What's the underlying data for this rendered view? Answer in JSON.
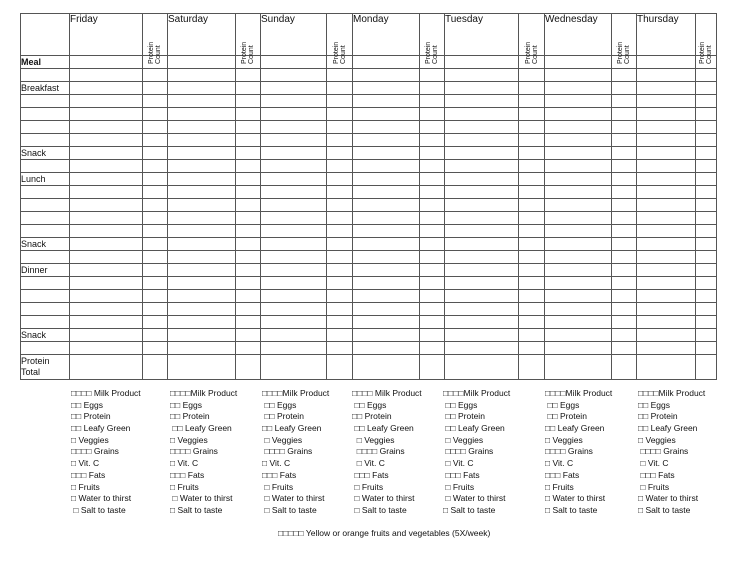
{
  "header": {
    "days": [
      "Friday",
      "Saturday",
      "Sunday",
      "Monday",
      "Tuesday",
      "Wednesday",
      "Thursday"
    ],
    "protein_count_label": [
      "Protein",
      "Count"
    ]
  },
  "rows": [
    {
      "label": "Meal",
      "bold": true
    },
    {
      "label": ""
    },
    {
      "label": "Breakfast"
    },
    {
      "label": ""
    },
    {
      "label": ""
    },
    {
      "label": ""
    },
    {
      "label": ""
    },
    {
      "label": "Snack"
    },
    {
      "label": ""
    },
    {
      "label": "Lunch"
    },
    {
      "label": ""
    },
    {
      "label": ""
    },
    {
      "label": ""
    },
    {
      "label": ""
    },
    {
      "label": "Snack"
    },
    {
      "label": ""
    },
    {
      "label": "Dinner"
    },
    {
      "label": ""
    },
    {
      "label": ""
    },
    {
      "label": ""
    },
    {
      "label": ""
    },
    {
      "label": "Snack"
    },
    {
      "label": ""
    },
    {
      "label": "Protein Total",
      "lines": [
        "Protein",
        "Total"
      ]
    }
  ],
  "checklists": [
    {
      "day": "Friday",
      "items": [
        "□□□□ Milk Product",
        "□□ Eggs",
        "□□ Protein",
        "□□ Leafy Green",
        "□ Veggies",
        "□□□□ Grains",
        "□ Vit. C",
        "□□□ Fats",
        "□ Fruits",
        "□ Water to thirst",
        " □ Salt to taste"
      ]
    },
    {
      "day": "Saturday",
      "items": [
        "□□□□Milk Product",
        "□□ Eggs",
        "□□ Protein",
        " □□ Leafy Green",
        "□ Veggies",
        "□□□□ Grains",
        "□ Vit. C",
        "□□□ Fats",
        "□ Fruits",
        " □ Water to thirst",
        "□ Salt to taste"
      ]
    },
    {
      "day": "Sunday",
      "items": [
        "□□□□Milk Product",
        " □□ Eggs",
        " □□ Protein",
        "□□ Leafy Green",
        " □ Veggies",
        " □□□□ Grains",
        "□ Vit. C",
        "□□□ Fats",
        " □ Fruits",
        " □ Water to thirst",
        " □ Salt to taste"
      ]
    },
    {
      "day": "Monday",
      "items": [
        "□□□□ Milk Product",
        " □□ Eggs",
        "□□ Protein",
        " □□ Leafy Green",
        "  □ Veggies",
        "  □□□□ Grains",
        "  □ Vit. C",
        " □□□ Fats",
        " □ Fruits",
        " □ Water to thirst",
        " □ Salt to taste"
      ]
    },
    {
      "day": "Tuesday",
      "items": [
        "□□□□Milk Product",
        " □□ Eggs",
        " □□ Protein",
        " □□ Leafy Green",
        " □ Veggies",
        " □□□□ Grains",
        " □ Vit. C",
        " □□□ Fats",
        " □ Fruits",
        " □ Water to thirst",
        "□ Salt to taste"
      ]
    },
    {
      "day": "Wednesday",
      "items": [
        "□□□□Milk Product",
        " □□ Eggs",
        " □□ Protein",
        "□□ Leafy Green",
        "□ Veggies",
        "□□□□ Grains",
        "□ Vit. C",
        "□□□ Fats",
        "□ Fruits",
        "□ Water to thirst",
        "□ Salt to taste"
      ]
    },
    {
      "day": "Thursday",
      "items": [
        "□□□□Milk Product",
        "□□ Eggs",
        "□□ Protein",
        "□□ Leafy Green",
        "□ Veggies",
        " □□□□ Grains",
        " □ Vit. C",
        " □□□ Fats",
        " □ Fruits",
        "□ Water to thirst",
        "□ Salt to taste"
      ]
    }
  ],
  "footnote": "□□□□□ Yellow or orange fruits and vegetables (5X/week)"
}
